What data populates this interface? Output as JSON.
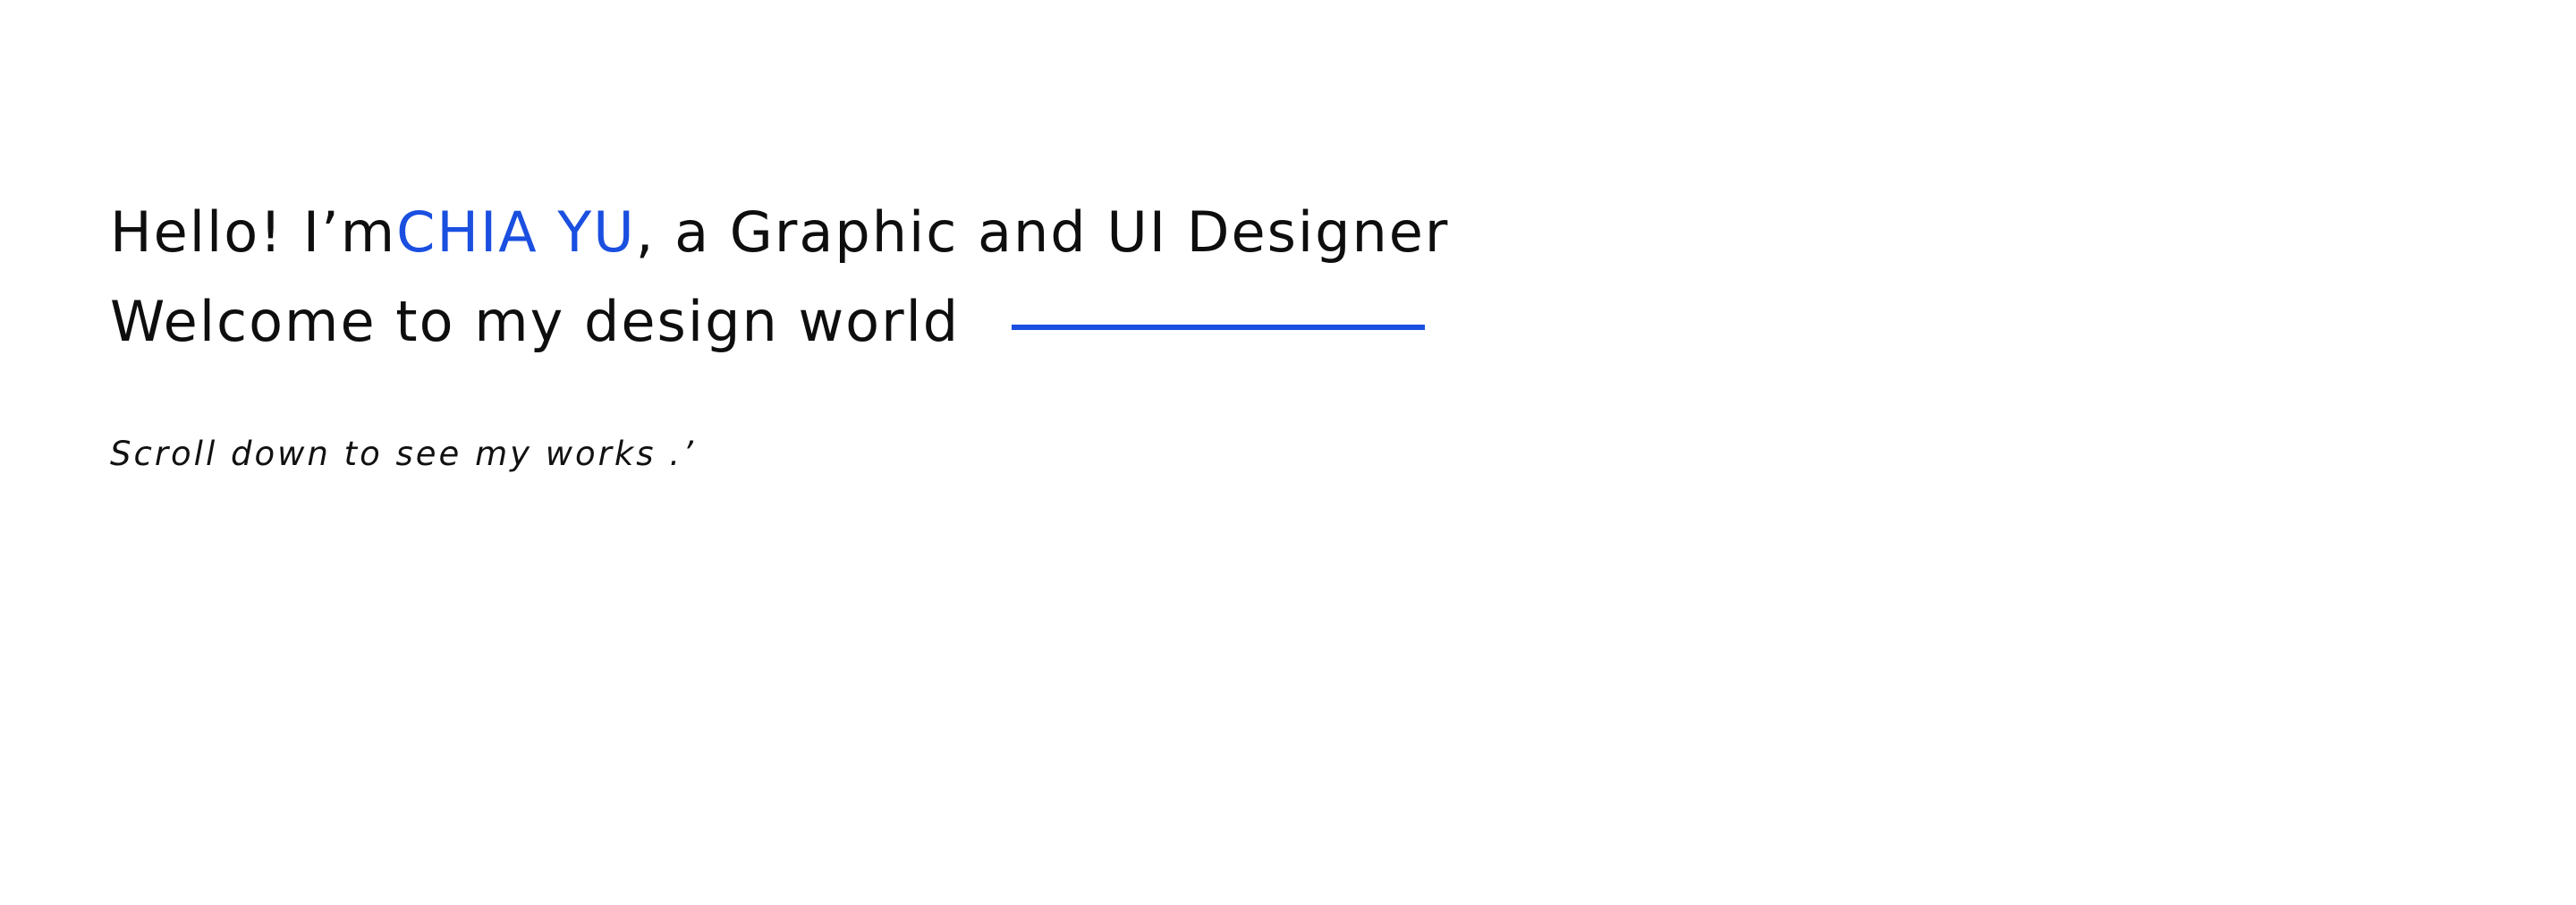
{
  "hero": {
    "greeting_prefix": "Hello! I’m ",
    "name": "CHIA YU",
    "greeting_suffix": ", a Graphic and UI Designer",
    "welcome": "Welcome to my design world",
    "scroll_hint": "Scroll down to see my works .’"
  },
  "colors": {
    "accent": "#1a4fe0",
    "text": "#111111",
    "background": "#ffffff"
  }
}
